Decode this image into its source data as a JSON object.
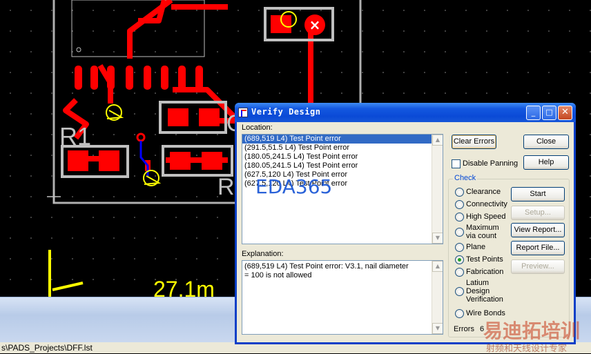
{
  "dialog": {
    "title": "Verify Design",
    "minimize_glyph": "_",
    "maximize_glyph": "□",
    "close_glyph": "✕",
    "location_label": "Location:",
    "location_items": [
      "(689,519 L4) Test Point error",
      "(291.5,51.5 L4) Test Point error",
      "(180.05,241.5 L4) Test Point error",
      "(180.05,241.5 L4) Test Point error",
      "(627.5,120 L4) Test Point error",
      "(627.5,120 L4) Test Point error"
    ],
    "selected_index": 0,
    "explanation_label": "Explanation:",
    "explanation_text": "(689,519 L4) Test Point error: V3.1, nail diameter\n= 100 is not allowed",
    "buttons": {
      "clear_errors": "Clear Errors",
      "close": "Close",
      "help": "Help",
      "start": "Start",
      "setup": "Setup...",
      "view_report": "View Report...",
      "report_file": "Report File...",
      "preview": "Preview..."
    },
    "disable_panning_label": "Disable Panning",
    "disable_panning_checked": false,
    "check_group_title": "Check",
    "check_options": [
      "Clearance",
      "Connectivity",
      "High Speed",
      "Maximum via count",
      "Plane",
      "Test Points",
      "Fabrication",
      "Latium Design Verification",
      "Wire Bonds"
    ],
    "selected_check": "Test Points",
    "errors_label": "Errors",
    "errors_count": "6"
  },
  "statusbar": {
    "path": "s\\PADS_Projects\\DFF.lst"
  },
  "pcb": {
    "ref_r1": "R1",
    "ref_r": "R",
    "ref_c": "C",
    "dimension_text": "27.1m"
  },
  "watermarks": {
    "eda": "EDA365",
    "site_cn": "易迪拓培训",
    "site_sub": "射频和天线设计专家"
  },
  "colors": {
    "copper": "#ff0000",
    "silkscreen": "#c0c0c0",
    "testpoint": "#ffff00",
    "via": "#0000ff",
    "dimension": "#ffff00",
    "titlebar": "#0a4ad6"
  }
}
